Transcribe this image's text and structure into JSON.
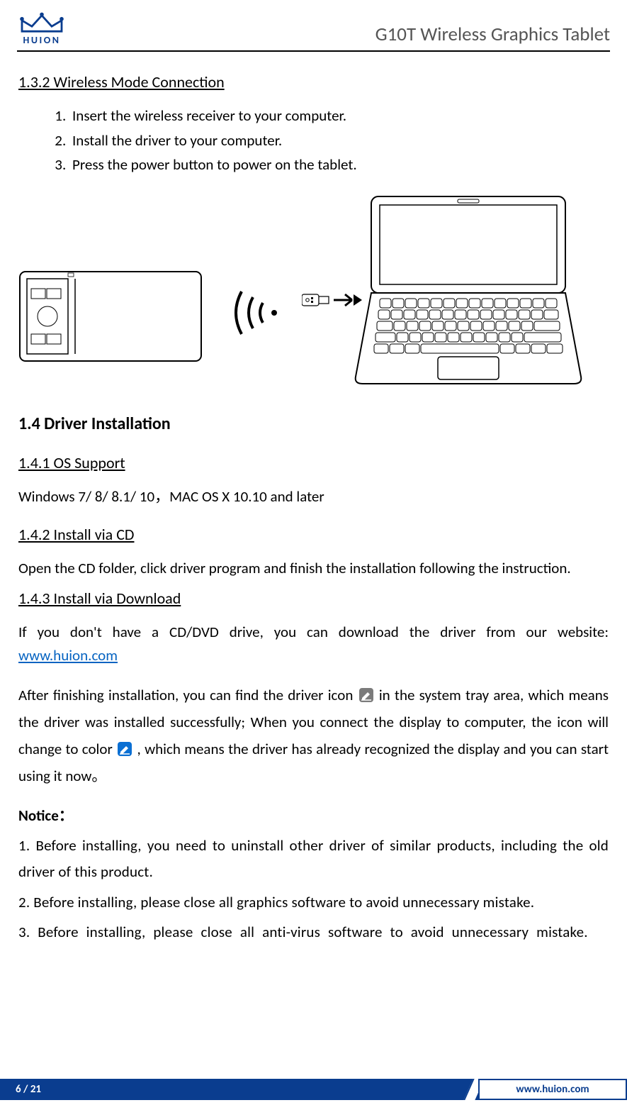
{
  "header": {
    "brand": "HUION",
    "doc_title": "G10T Wireless Graphics Tablet"
  },
  "sec132": {
    "title": "1.3.2 Wireless Mode Connection",
    "steps": [
      "Insert the wireless receiver to your computer.",
      "Install the driver to your computer.",
      "Press the power button to power on the tablet."
    ]
  },
  "sec14": {
    "title": "1.4 Driver Installation"
  },
  "sec141": {
    "title": "1.4.1 OS Support",
    "body": "Windows 7/ 8/ 8.1/ 10，MAC OS X 10.10 and later"
  },
  "sec142": {
    "title": "1.4.2 Install via CD",
    "body": "Open the CD folder, click driver program and finish the installation following the instruction."
  },
  "sec143": {
    "title": "1.4.3 Install via Download",
    "body_before_link": "If you don't have a CD/DVD drive, you can download the driver from our website: ",
    "link": "www.huion.com"
  },
  "post_install": {
    "p1": "After finishing installation, you can find the driver icon ",
    "p2": " in the system tray area, which means the driver was installed successfully; When you connect the display to computer, the icon will change to color ",
    "p3": " , which means the driver has already recognized the display and you can start using it now。"
  },
  "notice": {
    "heading": "Notice：",
    "items": [
      "1. Before installing, you need to uninstall other driver of similar products, including the old driver of this product.",
      "2. Before installing, please close all graphics software to avoid unnecessary mistake.",
      "3. Before installing, please close all anti-virus software to avoid unnecessary mistake."
    ]
  },
  "footer": {
    "page": "6 / 21",
    "url": "www.huion.com"
  }
}
